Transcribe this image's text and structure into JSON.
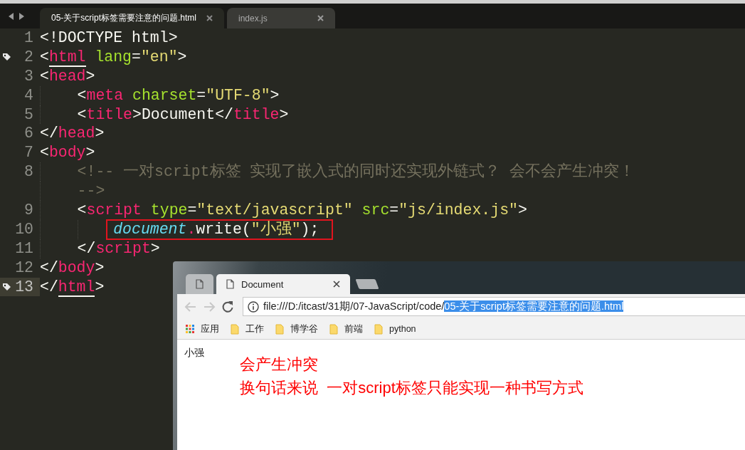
{
  "editor": {
    "tabs": [
      {
        "title": "05-关于script标签需要注意的问题.html",
        "selected": true
      },
      {
        "title": "index.js",
        "selected": false
      }
    ],
    "lines": [
      {
        "number": "1",
        "bookmark": false,
        "current": false,
        "boxed": false,
        "segments": [
          {
            "text": "<!DOCTYPE html>",
            "kind": "punct"
          }
        ]
      },
      {
        "number": "2",
        "bookmark": true,
        "current": false,
        "boxed": false,
        "segments": [
          {
            "text": "<",
            "kind": "punct"
          },
          {
            "text": "html",
            "kind": "tag-matched"
          },
          {
            "text": " lang",
            "kind": "attr"
          },
          {
            "text": "=",
            "kind": "punct"
          },
          {
            "text": "\"en\"",
            "kind": "string"
          },
          {
            "text": ">",
            "kind": "punct"
          }
        ]
      },
      {
        "number": "3",
        "bookmark": false,
        "current": false,
        "boxed": false,
        "segments": [
          {
            "text": "<",
            "kind": "punct"
          },
          {
            "text": "head",
            "kind": "tag"
          },
          {
            "text": ">",
            "kind": "punct"
          }
        ],
        "children": [
          {
            "number": "4",
            "bookmark": false,
            "current": false,
            "boxed": false,
            "segments": [
              {
                "text": "<",
                "kind": "punct"
              },
              {
                "text": "meta",
                "kind": "tag"
              },
              {
                "text": " charset",
                "kind": "attr"
              },
              {
                "text": "=",
                "kind": "punct"
              },
              {
                "text": "\"UTF-8\"",
                "kind": "string"
              },
              {
                "text": ">",
                "kind": "punct"
              }
            ]
          },
          {
            "number": "5",
            "bookmark": false,
            "current": false,
            "boxed": false,
            "segments": [
              {
                "text": "<",
                "kind": "punct"
              },
              {
                "text": "title",
                "kind": "tag"
              },
              {
                "text": ">Document</",
                "kind": "punct"
              },
              {
                "text": "title",
                "kind": "tag"
              },
              {
                "text": ">",
                "kind": "punct"
              }
            ]
          }
        ]
      },
      {
        "number": "6",
        "bookmark": false,
        "current": false,
        "boxed": false,
        "segments": [
          {
            "text": "</",
            "kind": "punct"
          },
          {
            "text": "head",
            "kind": "tag"
          },
          {
            "text": ">",
            "kind": "punct"
          }
        ]
      },
      {
        "number": "7",
        "bookmark": false,
        "current": false,
        "boxed": false,
        "segments": [
          {
            "text": "<",
            "kind": "punct"
          },
          {
            "text": "body",
            "kind": "tag"
          },
          {
            "text": ">",
            "kind": "punct"
          }
        ],
        "children": [
          {
            "number": "8",
            "bookmark": false,
            "current": false,
            "boxed": false,
            "segments": [
              {
                "text": "<!-- 一对script标签 实现了嵌入式的同时还实现外链式？ 会不会产生冲突！",
                "kind": "comment"
              }
            ],
            "continuation": [
              {
                "text": "-->",
                "kind": "comment"
              }
            ]
          },
          {
            "number": "9",
            "bookmark": false,
            "current": false,
            "boxed": false,
            "segments": [
              {
                "text": "<",
                "kind": "punct"
              },
              {
                "text": "script",
                "kind": "tag"
              },
              {
                "text": " type",
                "kind": "attr"
              },
              {
                "text": "=",
                "kind": "punct"
              },
              {
                "text": "\"text/javascript\"",
                "kind": "string"
              },
              {
                "text": " src",
                "kind": "attr"
              },
              {
                "text": "=",
                "kind": "punct"
              },
              {
                "text": "\"js/index.js\"",
                "kind": "string"
              },
              {
                "text": ">",
                "kind": "punct"
              }
            ],
            "children": [
              {
                "number": "10",
                "bookmark": false,
                "current": false,
                "boxed": true,
                "segments": [
                  {
                    "text": "document",
                    "kind": "object"
                  },
                  {
                    "text": ".",
                    "kind": "tag"
                  },
                  {
                    "text": "write(",
                    "kind": "punct"
                  },
                  {
                    "text": "\"小强\"",
                    "kind": "string"
                  },
                  {
                    "text": ");",
                    "kind": "punct"
                  }
                ]
              }
            ]
          },
          {
            "number": "11",
            "bookmark": false,
            "current": false,
            "boxed": false,
            "segments": [
              {
                "text": "</",
                "kind": "punct"
              },
              {
                "text": "script",
                "kind": "tag"
              },
              {
                "text": ">",
                "kind": "punct"
              }
            ]
          }
        ]
      },
      {
        "number": "12",
        "bookmark": false,
        "current": false,
        "boxed": false,
        "segments": [
          {
            "text": "</",
            "kind": "punct"
          },
          {
            "text": "body",
            "kind": "tag"
          },
          {
            "text": ">",
            "kind": "punct"
          }
        ]
      },
      {
        "number": "13",
        "bookmark": true,
        "current": true,
        "boxed": false,
        "segments": [
          {
            "text": "</",
            "kind": "punct"
          },
          {
            "text": "html",
            "kind": "tag-matched"
          },
          {
            "text": ">",
            "kind": "punct"
          }
        ]
      }
    ]
  },
  "browser": {
    "tabs": [
      {
        "selected": false
      },
      {
        "title": "Document",
        "selected": true
      }
    ],
    "back_enabled": false,
    "forward_enabled": false,
    "address": {
      "url": "file:///D:/itcast/31期/07-JavaScript/code/",
      "url_selected": "05-关于script标签需要注意的问题.html"
    },
    "bookmarks": [
      {
        "label": "应用",
        "kind": "apps"
      },
      {
        "label": "工作",
        "kind": "folder"
      },
      {
        "label": "博学谷",
        "kind": "folder"
      },
      {
        "label": "前端",
        "kind": "folder"
      },
      {
        "label": "python",
        "kind": "folder"
      }
    ],
    "page_text": "小强",
    "annotations": [
      "会产生冲突",
      "换句话来说  一对script标签只能实现一种书写方式"
    ]
  }
}
